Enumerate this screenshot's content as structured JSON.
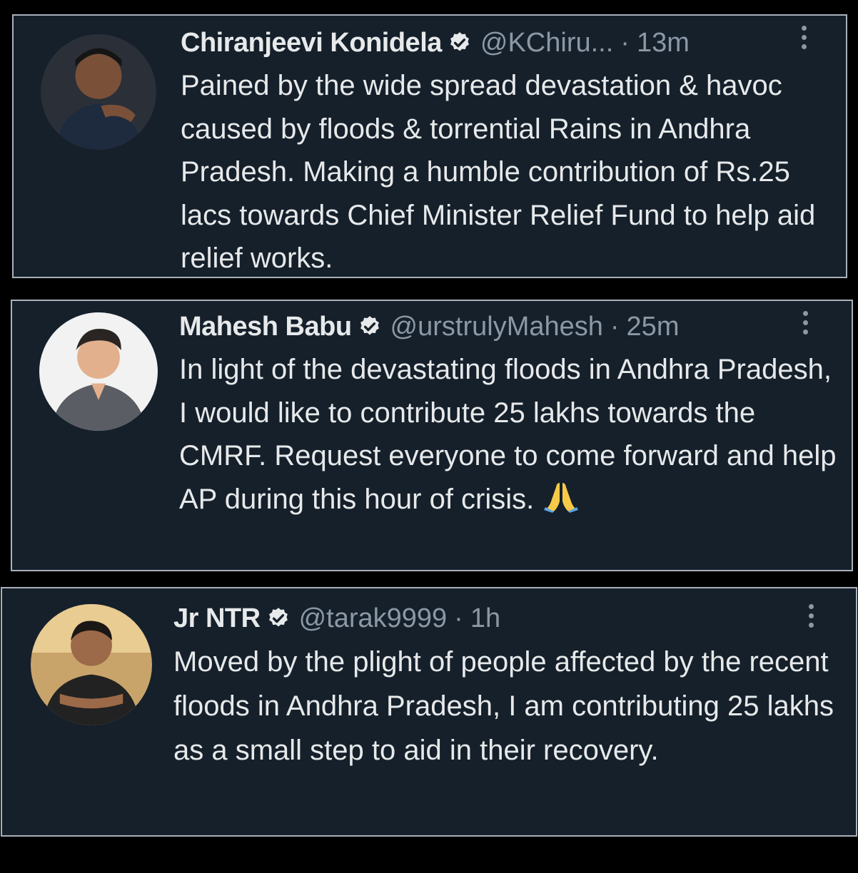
{
  "tweets": [
    {
      "name": "Chiranjeevi Konidela",
      "handle": "@KChiru...",
      "separator": "·",
      "time": "13m",
      "verified": true,
      "text": "Pained by the wide spread devastation & havoc caused by floods & torrential Rains in Andhra Pradesh. Making a humble contribution of Rs.25 lacs towards Chief Minister Relief Fund to help aid relief works."
    },
    {
      "name": "Mahesh Babu",
      "handle": "@urstrulyMahesh",
      "separator": "·",
      "time": "25m",
      "verified": true,
      "text": "In light of the devastating floods in Andhra Pradesh, I would like to contribute 25 lakhs towards the CMRF. Request everyone to come forward and help AP during this hour of crisis.",
      "emoji": "folded-hands"
    },
    {
      "name": "Jr NTR",
      "handle": "@tarak9999",
      "separator": "·",
      "time": "1h",
      "verified": true,
      "text": "Moved by the plight of people affected by the recent floods in Andhra Pradesh, I am contributing 25 lakhs as a small step to aid in their recovery."
    }
  ],
  "colors": {
    "card_background": "#15202b",
    "card_border": "#a9b1ba",
    "primary_text": "#e7e9ea",
    "secondary_text": "#8b98a5",
    "page_background": "#000000"
  }
}
